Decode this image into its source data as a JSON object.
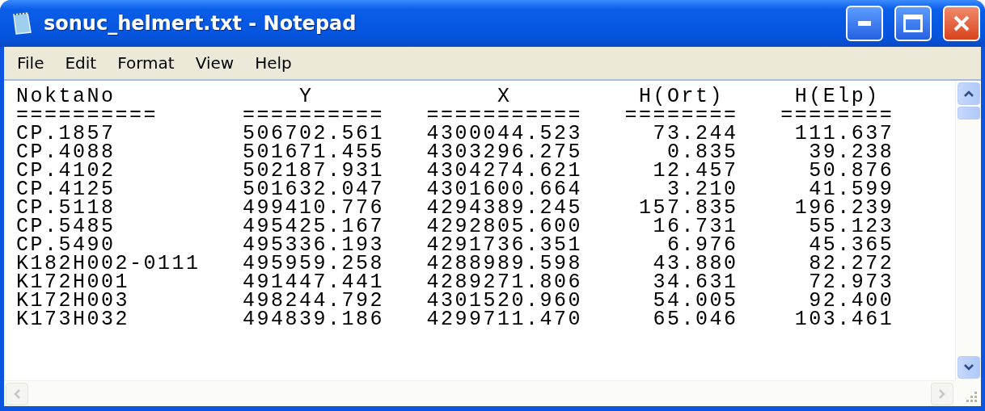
{
  "window": {
    "title": "sonuc_helmert.txt - Notepad"
  },
  "menu": [
    "File",
    "Edit",
    "Format",
    "View",
    "Help"
  ],
  "lines": [
    "NoktaNo             Y             X         H(Ort)     H(Elp)",
    "==========      ==========   ===========   ========   ========",
    "CP.1857         506702.561   4300044.523     73.244    111.637",
    "CP.4088         501671.455   4303296.275      0.835     39.238",
    "CP.4102         502187.931   4304274.621     12.457     50.876",
    "CP.4125         501632.047   4301600.664      3.210     41.599",
    "CP.5118         499410.776   4294389.245    157.835    196.239",
    "CP.5485         495425.167   4292805.600     16.731     55.123",
    "CP.5490         495336.193   4291736.351      6.976     45.365",
    "K182H002-0111   495959.258   4288989.598     43.880     82.272",
    "K172H001        491447.441   4289271.806     34.631     72.973",
    "K172H003        498244.792   4301520.960     54.005     92.400",
    "K173H032        494839.186   4299711.470     65.046    103.461"
  ]
}
